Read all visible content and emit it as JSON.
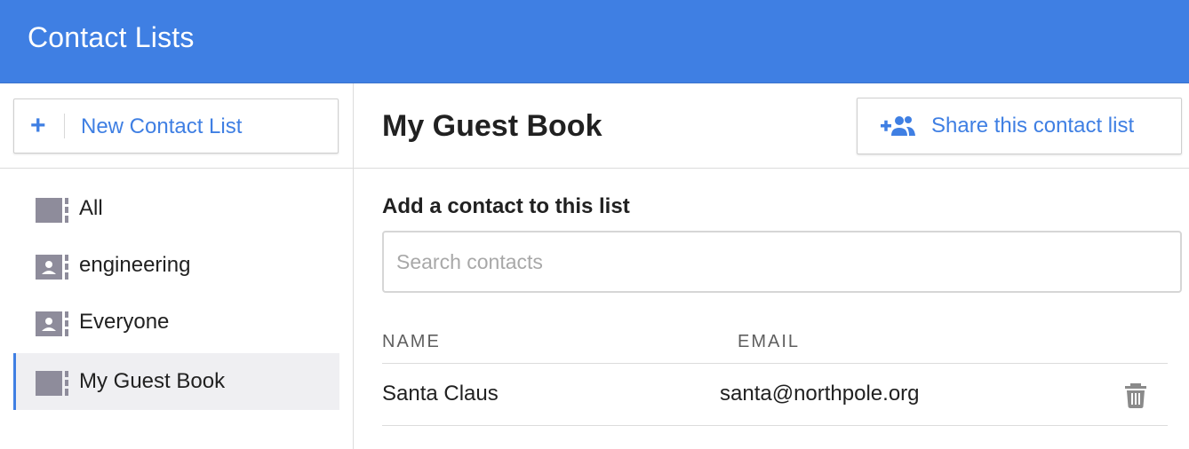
{
  "header": {
    "title": "Contact Lists",
    "color": "#3f7fe3"
  },
  "sidebar": {
    "new_list_button": {
      "icon": "plus-icon",
      "label": "New Contact List"
    },
    "items": [
      {
        "label": "All",
        "icon": "contact-list-icon",
        "active": false
      },
      {
        "label": "engineering",
        "icon": "contact-card-icon",
        "active": false
      },
      {
        "label": "Everyone",
        "icon": "contact-card-icon",
        "active": false
      },
      {
        "label": "My Guest Book",
        "icon": "contact-list-icon",
        "active": true
      }
    ]
  },
  "main": {
    "title": "My Guest Book",
    "share_button": {
      "icon": "add-group-icon",
      "label": "Share this contact list"
    },
    "add_contact": {
      "heading": "Add a contact to this list",
      "search_placeholder": "Search contacts",
      "search_value": ""
    },
    "table": {
      "columns": [
        "NAME",
        "EMAIL"
      ],
      "rows": [
        {
          "name": "Santa Claus",
          "email": "santa@northpole.org",
          "action_icon": "trash-icon"
        }
      ]
    }
  },
  "colors": {
    "accent": "#3f7fe3",
    "icon_gray": "#8e8c9b",
    "active_bg": "#efeff2"
  }
}
